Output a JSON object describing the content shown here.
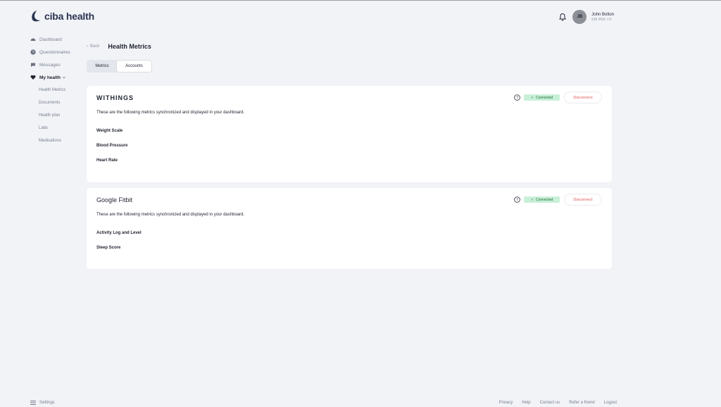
{
  "brand": {
    "name": "ciba health"
  },
  "sidebar": {
    "items": [
      {
        "label": "Dashboard",
        "icon": "dashboard-icon"
      },
      {
        "label": "Questionnaires",
        "icon": "question-icon"
      },
      {
        "label": "Messages",
        "icon": "chat-icon"
      },
      {
        "label": "My health",
        "icon": "heart-icon",
        "active": true
      }
    ],
    "subitems": [
      "Health Metrics",
      "Documents",
      "Health plan",
      "Labs",
      "Medications"
    ]
  },
  "header": {
    "user_initials": "JB",
    "user_name": "John Bolton",
    "user_sub": "EBI MSK C4"
  },
  "breadcrumb": {
    "back": "Back",
    "title": "Health Metrics"
  },
  "tabs": [
    "Metrics",
    "Accounts"
  ],
  "cards": [
    {
      "title": "WITHINGS",
      "status": "Connected",
      "action": "Disconnect",
      "description": "These are the following metrics synchronized and displayed in your dashboard.",
      "metrics": [
        "Weight Scale",
        "Blood Pressure",
        "Heart Rate"
      ]
    },
    {
      "title": "Google Fitbit",
      "status": "Connected",
      "action": "Disconnect",
      "description": "These are the following metrics synchronized and displayed in your dashboard.",
      "metrics": [
        "Activity Log and Level",
        "Sleep Score"
      ]
    }
  ],
  "footer": {
    "settings": "Settings",
    "links": [
      "Privacy",
      "Help",
      "Contact us",
      "Refer a friend",
      "Logout"
    ]
  },
  "colors": {
    "connected_bg": "#c8f0d8",
    "disconnect": "#e05656",
    "brand": "#2b3350"
  }
}
